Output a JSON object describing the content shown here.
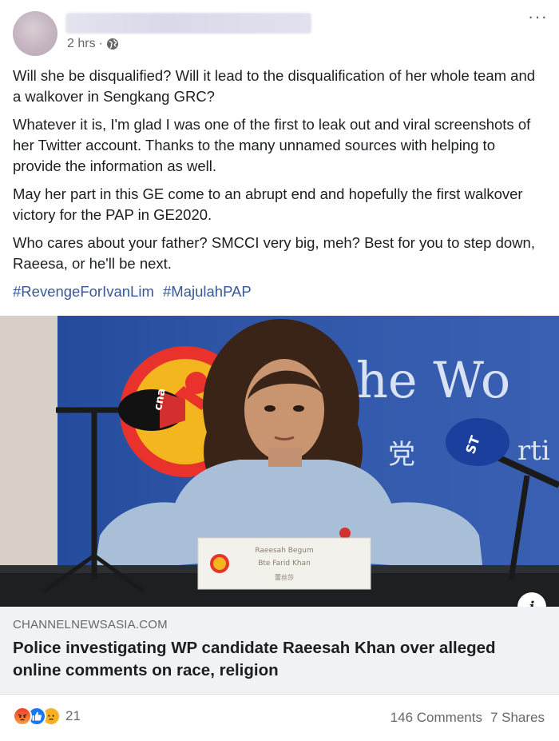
{
  "post": {
    "time": "2 hrs",
    "separator": "·",
    "privacy_icon": "globe-icon",
    "more_icon": "more-options-icon",
    "paragraphs": [
      "Will she be disqualified? Will it lead to the disqualification of her whole team and a walkover in Sengkang GRC?",
      "Whatever it is, I'm glad I was one of the first to leak out and viral screenshots of her Twitter account. Thanks to the many unnamed sources with helping to provide the information as well.",
      "May her part in this GE come to an abrupt end and hopefully the first walkover victory for the PAP in GE2020.",
      "Who cares about your father? SMCCI very big, meh? Best for you to step down, Raeesa, or he'll be next."
    ],
    "hashtags": [
      "#RevengeForIvanLim",
      "#MajulahPAP"
    ]
  },
  "photo": {
    "backdrop_text_1": "he Wo",
    "backdrop_text_2": "党",
    "backdrop_text_3": "rti",
    "mic_left_label": "cna",
    "mic_right_label": "ST",
    "nameplate_line1": "Raeesah Begum",
    "nameplate_line2": "Bte Farid Khan",
    "nameplate_line3": "蕾丝莎"
  },
  "link": {
    "domain": "CHANNELNEWSASIA.COM",
    "title": "Police investigating WP candidate Raeesah Khan over alleged online comments on race, religion",
    "info_label": "i"
  },
  "footer": {
    "reaction_icons": [
      "angry-icon",
      "like-icon",
      "sad-icon"
    ],
    "reaction_count": "21",
    "comments": "146 Comments",
    "shares": "7 Shares"
  },
  "colors": {
    "hashtag": "#385898",
    "secondary_text": "#65676b",
    "link_bg": "#f0f2f5",
    "photo_backdrop": "#2b4fa0",
    "like_blue": "#1877f2"
  }
}
